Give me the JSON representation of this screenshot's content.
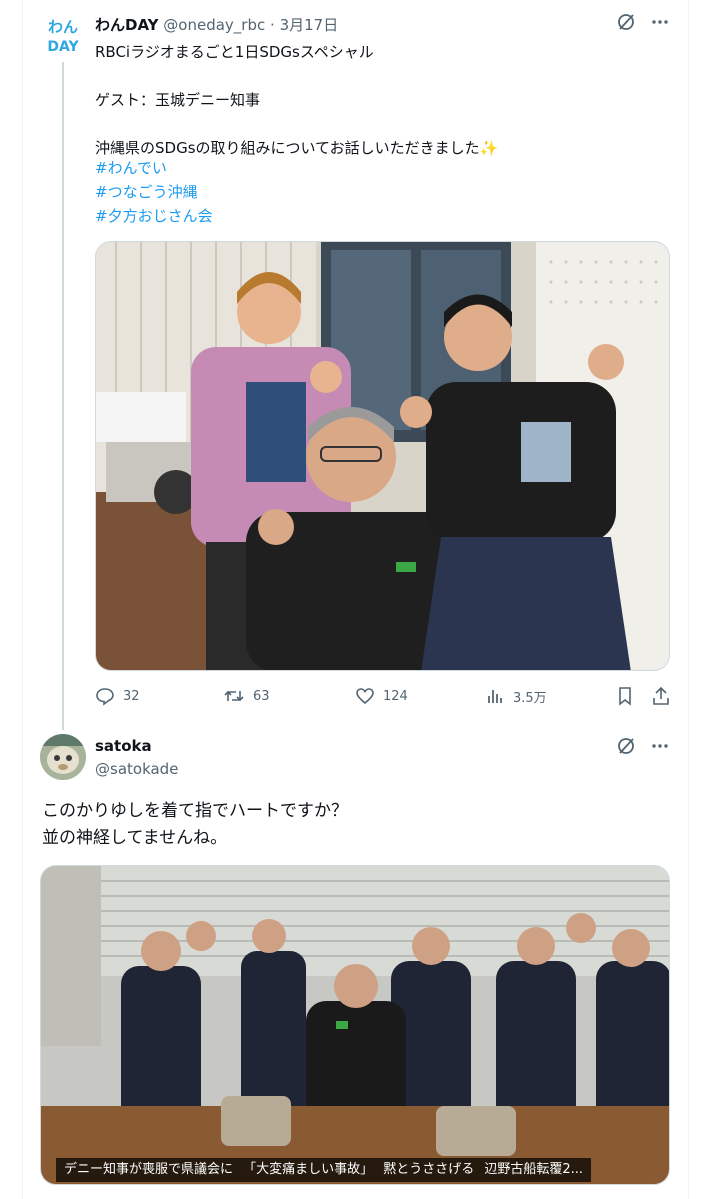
{
  "tweet1": {
    "avatar_text": "わん DAY",
    "display_name": "わんDAY",
    "handle": "@oneday_rbc",
    "separator": "·",
    "date": "3月17日",
    "body": "RBCiラジオまるごと1日SDGsスペシャル\n\nゲスト：玉城デニー知事\n\n沖縄県のSDGsの取り組みについてお話しいただきました✨",
    "hashtags": [
      "#わんでい",
      "#つなごう沖縄",
      "#夕方おじさん会"
    ],
    "actions": {
      "replies": "32",
      "reposts": "63",
      "likes": "124",
      "views": "3.5万"
    }
  },
  "tweet2": {
    "display_name": "satoka",
    "handle": "@satokade",
    "body": "このかりゆしを着て指でハートですか？\n並の神経してませんね。",
    "image_caption": "デニー知事が喪服で県議会に 「大変痛ましい事故」 黙とうささげる 辺野古船転覆2..."
  },
  "colors": {
    "accent": "#1d9bf0",
    "muted": "#536471",
    "text": "#0f1419",
    "border": "#cfd9de"
  },
  "icons": [
    "grok-icon",
    "more-icon",
    "reply-icon",
    "repost-icon",
    "like-icon",
    "views-icon",
    "bookmark-icon",
    "share-icon"
  ]
}
